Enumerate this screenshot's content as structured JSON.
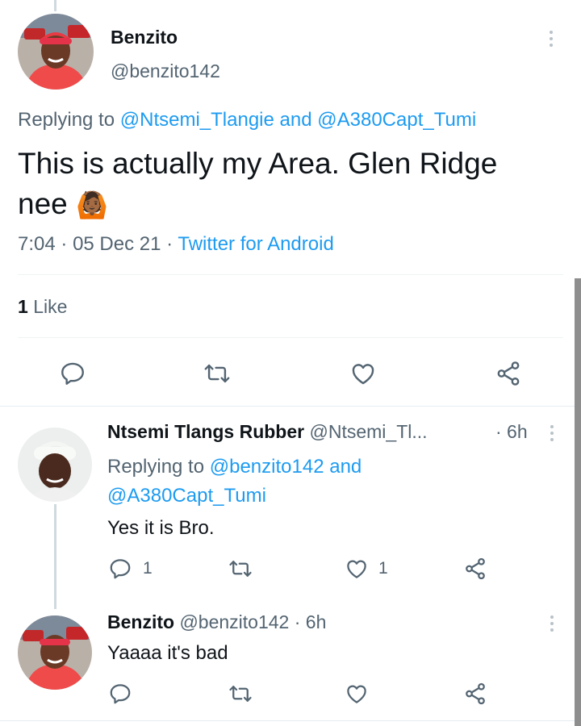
{
  "main_tweet": {
    "display_name": "Benzito",
    "handle": "@benzito142",
    "replying_prefix": "Replying to",
    "replying_user1": "@Ntsemi_Tlangie",
    "replying_and": "and",
    "replying_user2": "@A380Capt_Tumi",
    "text_line1": "This is actually my Area. Glen Ridge",
    "text_line2": "nee",
    "emoji": "🙆🏾",
    "time": "7:04",
    "sep1": "·",
    "date": "05 Dec 21",
    "sep2": "·",
    "source": "Twitter for Android",
    "likes_count": "1",
    "likes_label": "Like"
  },
  "reply1": {
    "display_name": "Ntsemi Tlangs Rubber",
    "handle": "@Ntsemi_Tl...",
    "time": "· 6h",
    "replying_prefix": "Replying to",
    "replying_user1": "@benzito142",
    "replying_and": "and",
    "replying_user2": "@A380Capt_Tumi",
    "text": "Yes it is Bro.",
    "reply_count": "1",
    "like_count": "1"
  },
  "reply2": {
    "display_name": "Benzito",
    "handle": "@benzito142",
    "time": "· 6h",
    "text": "Yaaaa it's bad"
  },
  "icons": [
    "more-icon",
    "reply-icon",
    "retweet-icon",
    "like-icon",
    "share-icon"
  ],
  "colors": {
    "link": "#1d9bf0",
    "muted": "#536471",
    "text": "#0f1419",
    "divider": "#eff3f4"
  }
}
